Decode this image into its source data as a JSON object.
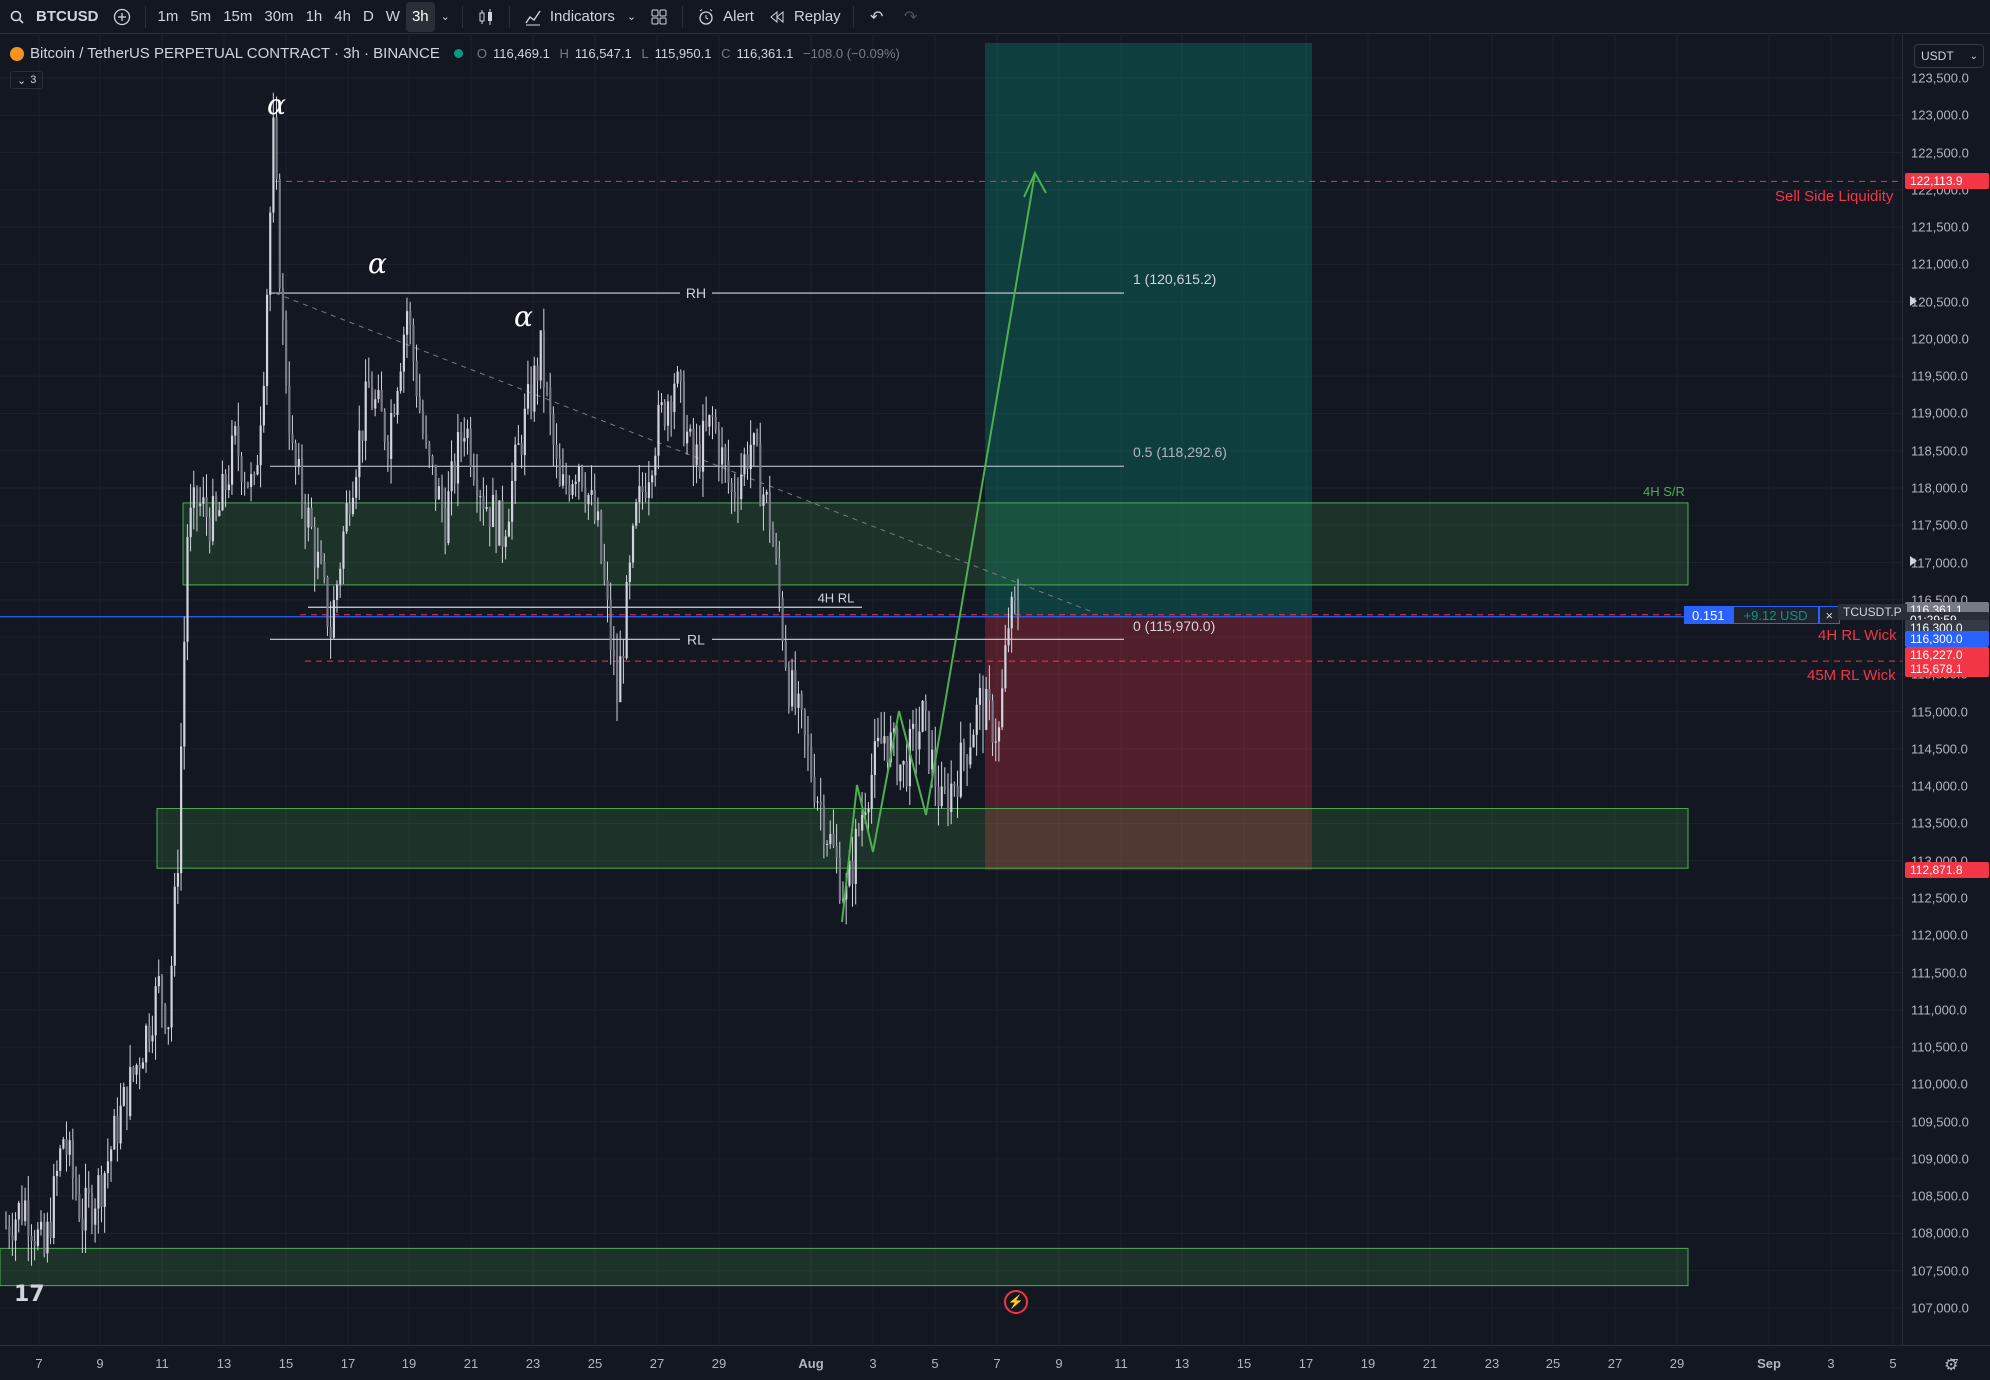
{
  "toolbar": {
    "symbol": "BTCUSD",
    "intervals": [
      "1m",
      "5m",
      "15m",
      "30m",
      "1h",
      "4h",
      "D",
      "W",
      "3h"
    ],
    "active_interval": "3h",
    "indicators_label": "Indicators",
    "alert_label": "Alert",
    "replay_label": "Replay"
  },
  "legend": {
    "title": "Bitcoin / TetherUS PERPETUAL CONTRACT · 3h · BINANCE",
    "open_label": "O",
    "open": "116,469.1",
    "high_label": "H",
    "high": "116,547.1",
    "low_label": "L",
    "low": "115,950.1",
    "close_label": "C",
    "close": "116,361.1",
    "change": "−108.0 (−0.09%)",
    "collapsed_count": "3"
  },
  "currency": "USDT",
  "price_axis": {
    "ticks": [
      "123,500.0",
      "123,000.0",
      "122,500.0",
      "122,000.0",
      "121,500.0",
      "121,000.0",
      "120,500.0",
      "120,000.0",
      "119,500.0",
      "119,000.0",
      "118,500.0",
      "118,000.0",
      "117,500.0",
      "117,000.0",
      "116,500.0",
      "116,000.0",
      "115,500.0",
      "115,000.0",
      "114,500.0",
      "114,000.0",
      "113,500.0",
      "113,000.0",
      "112,500.0",
      "112,000.0",
      "111,500.0",
      "111,000.0",
      "110,500.0",
      "110,000.0",
      "109,500.0",
      "109,000.0",
      "108,500.0",
      "108,000.0",
      "107,500.0",
      "107,000.0"
    ],
    "tags": {
      "sell_side": "122,113.9",
      "last_price": "116,361.1",
      "countdown": "01:29:59",
      "rl_wick": "116,300.0",
      "position": "116,300.0",
      "m45_wick": "116,227.0",
      "stop": "115,678.1",
      "target_low": "112,871.8"
    }
  },
  "time_axis": {
    "labels": [
      "7",
      "9",
      "11",
      "13",
      "15",
      "17",
      "19",
      "21",
      "23",
      "25",
      "27",
      "29",
      "Aug",
      "3",
      "5",
      "7",
      "9",
      "11",
      "13",
      "15",
      "17",
      "19",
      "21",
      "23",
      "25",
      "27",
      "29",
      "Sep",
      "3",
      "5",
      "7"
    ]
  },
  "annotations": {
    "rh": "RH",
    "rl": "RL",
    "rl_4h": "4H RL",
    "fib_1": "1 (120,615.2)",
    "fib_05": "0.5 (118,292.6)",
    "fib_0": "0 (115,970.0)",
    "sr_4h": "4H S/R",
    "sell_side_liquidity": "Sell Side Liquidity",
    "rl_wick_4h": "4H RL Wick",
    "rl_wick_45m": "45M RL Wick",
    "alpha": "α"
  },
  "position": {
    "quantity": "0.151",
    "pnl": "+9.12 USD",
    "close": "×",
    "symbol_tag": "TCUSDT.P"
  },
  "colors": {
    "bg": "#131722",
    "candle": "#d1d4dc",
    "zone_fill": "rgba(76,175,80,0.18)",
    "zone_border": "#4caf50",
    "target_fill": "rgba(8,153,129,0.30)",
    "stop_fill": "rgba(242,54,69,0.28)",
    "red_line": "#f23645",
    "green_arrow": "#4caf50",
    "position_line": "#2962ff"
  },
  "chart_data": {
    "type": "candlestick",
    "symbol": "BTCUSDT.P",
    "interval": "3h",
    "ylim": [
      107000,
      123600
    ],
    "x": [
      "7",
      "9",
      "11",
      "13",
      "15",
      "17",
      "19",
      "21",
      "23",
      "25",
      "27",
      "29",
      "Aug",
      "3",
      "5",
      "7",
      "9",
      "11",
      "13",
      "15",
      "17",
      "19",
      "21",
      "23",
      "25",
      "27",
      "29",
      "Sep",
      "3",
      "5",
      "7"
    ],
    "price_path": [
      [
        0,
        108100
      ],
      [
        2,
        108400
      ],
      [
        4,
        107700
      ],
      [
        6,
        109300
      ],
      [
        8,
        108200
      ],
      [
        10,
        108700
      ],
      [
        12,
        109600
      ],
      [
        14,
        110400
      ],
      [
        16,
        111300
      ],
      [
        17,
        110900
      ],
      [
        18,
        113100
      ],
      [
        19,
        117400
      ],
      [
        20,
        117800
      ],
      [
        22,
        117500
      ],
      [
        24,
        118600
      ],
      [
        26,
        117900
      ],
      [
        27,
        119700
      ],
      [
        28,
        122700
      ],
      [
        29,
        120100
      ],
      [
        30,
        118400
      ],
      [
        32,
        117400
      ],
      [
        34,
        116100
      ],
      [
        36,
        118000
      ],
      [
        38,
        119300
      ],
      [
        40,
        118700
      ],
      [
        42,
        120400
      ],
      [
        44,
        118400
      ],
      [
        46,
        117600
      ],
      [
        48,
        118900
      ],
      [
        50,
        117900
      ],
      [
        52,
        117400
      ],
      [
        54,
        118700
      ],
      [
        56,
        119800
      ],
      [
        58,
        117900
      ],
      [
        60,
        118400
      ],
      [
        62,
        117400
      ],
      [
        64,
        115200
      ],
      [
        66,
        117600
      ],
      [
        68,
        118700
      ],
      [
        70,
        119500
      ],
      [
        72,
        118300
      ],
      [
        74,
        118900
      ],
      [
        76,
        117900
      ],
      [
        78,
        118600
      ],
      [
        80,
        117600
      ],
      [
        82,
        115400
      ],
      [
        84,
        114400
      ],
      [
        86,
        113400
      ],
      [
        88,
        112500
      ],
      [
        90,
        113900
      ],
      [
        92,
        114700
      ],
      [
        94,
        114200
      ],
      [
        96,
        114900
      ],
      [
        98,
        113700
      ],
      [
        100,
        114300
      ],
      [
        102,
        115100
      ],
      [
        104,
        114700
      ],
      [
        105,
        116200
      ],
      [
        106,
        116361
      ]
    ],
    "zones": [
      {
        "label": "4H S/R",
        "low": 116700,
        "high": 117800
      },
      {
        "label": "",
        "low": 112900,
        "high": 113700
      },
      {
        "label": "",
        "low": 107300,
        "high": 107800
      }
    ],
    "levels": {
      "sell_side_liquidity": 122113.9,
      "rh": 120615.2,
      "fib_05": 118292.6,
      "rl": 115970.0,
      "rl_4h": 116400,
      "rl_wick_4h": 116300,
      "rl_wick_45m": 115678.1
    },
    "long_position": {
      "entry": 116300.0,
      "target": 123500,
      "stop": 112871.8,
      "quantity": 0.151,
      "pnl_usd": 9.12
    }
  }
}
